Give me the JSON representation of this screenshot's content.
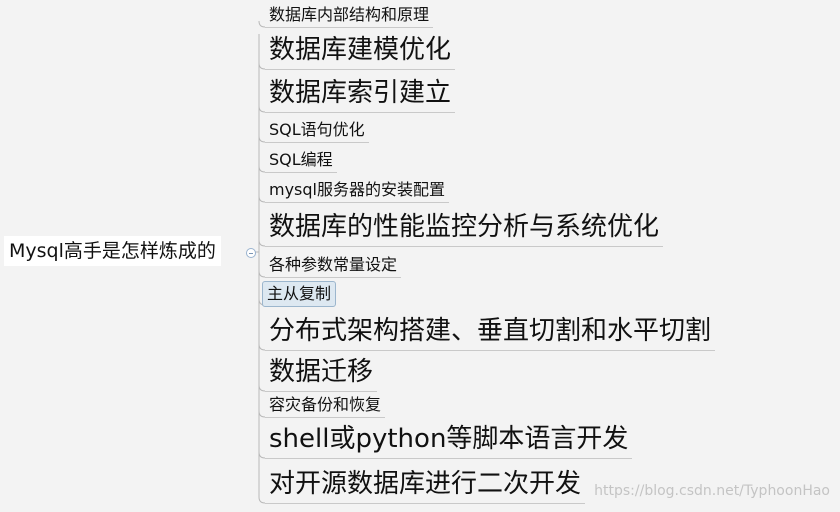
{
  "root": {
    "label": "Mysql高手是怎样炼成的"
  },
  "branches": [
    {
      "label": "数据库内部结构和原理",
      "size": "small"
    },
    {
      "label": "数据库建模优化",
      "size": "large"
    },
    {
      "label": "数据库索引建立",
      "size": "large"
    },
    {
      "label": "SQL语句优化",
      "size": "small"
    },
    {
      "label": "SQL编程",
      "size": "small"
    },
    {
      "label": "mysql服务器的安装配置",
      "size": "small"
    },
    {
      "label": "数据库的性能监控分析与系统优化",
      "size": "large"
    },
    {
      "label": "各种参数常量设定",
      "size": "small"
    },
    {
      "label": "主从复制",
      "size": "small",
      "selected": true
    },
    {
      "label": "分布式架构搭建、垂直切割和水平切割",
      "size": "large"
    },
    {
      "label": "数据迁移",
      "size": "large"
    },
    {
      "label": "容灾备份和恢复",
      "size": "small"
    },
    {
      "label": "shell或python等脚本语言开发",
      "size": "large"
    },
    {
      "label": "对开源数据库进行二次开发",
      "size": "large"
    }
  ],
  "watermark": "https://blog.csdn.net/TyphoonHao",
  "colors": {
    "background": "#f3f3f3",
    "connector": "#b8b8b8",
    "selected_fill": "#dde8f1",
    "selected_border": "#9cb6cd"
  }
}
